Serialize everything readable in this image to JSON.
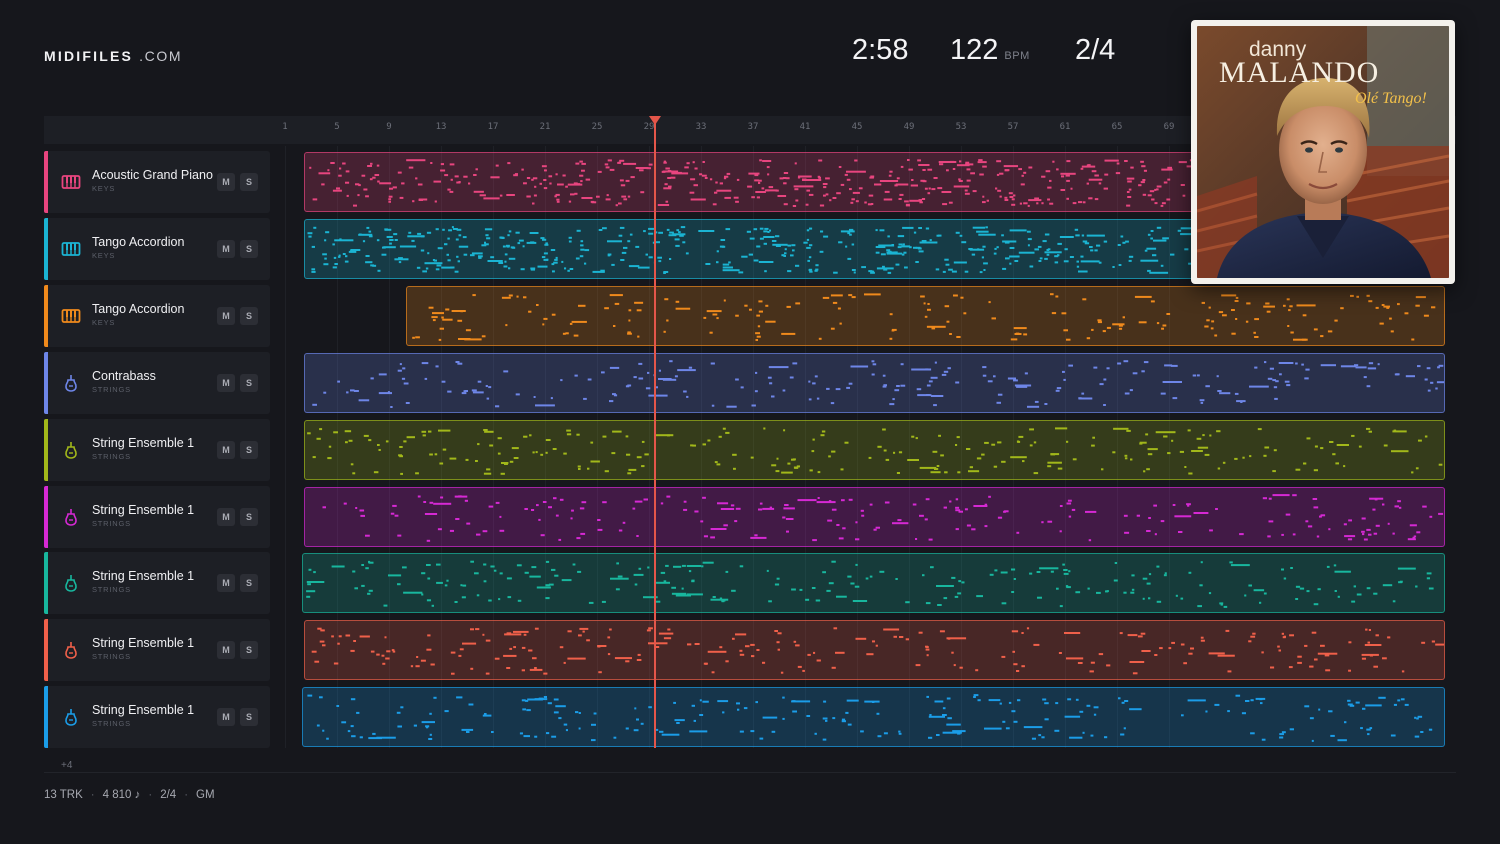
{
  "brand": {
    "name_bold": "MIDIFILES",
    "name_suffix": ".COM"
  },
  "stats": {
    "time": "2:58",
    "tempo": "122",
    "tempo_unit": "BPM",
    "time_signature": "2/4"
  },
  "ruler": {
    "ticks": [
      "1",
      "5",
      "9",
      "13",
      "17",
      "21",
      "25",
      "29",
      "33",
      "37",
      "41",
      "45",
      "49",
      "53",
      "57",
      "61",
      "65",
      "69"
    ],
    "playhead_bar": 29
  },
  "tracks": [
    {
      "name": "Acoustic Grand Piano",
      "category": "KEYS",
      "color": "#e8457f",
      "icon": "piano-icon",
      "mute": "M",
      "solo": "S"
    },
    {
      "name": "Tango Accordion",
      "category": "KEYS",
      "color": "#1bb4d3",
      "icon": "piano-icon",
      "mute": "M",
      "solo": "S"
    },
    {
      "name": "Tango Accordion",
      "category": "KEYS",
      "color": "#f08a1c",
      "icon": "piano-icon",
      "mute": "M",
      "solo": "S"
    },
    {
      "name": "Contrabass",
      "category": "STRINGS",
      "color": "#6e86e8",
      "icon": "violin-icon",
      "mute": "M",
      "solo": "S"
    },
    {
      "name": "String Ensemble 1",
      "category": "STRINGS",
      "color": "#a2b81a",
      "icon": "violin-icon",
      "mute": "M",
      "solo": "S"
    },
    {
      "name": "String Ensemble 1",
      "category": "STRINGS",
      "color": "#d629d4",
      "icon": "violin-icon",
      "mute": "M",
      "solo": "S"
    },
    {
      "name": "String Ensemble 1",
      "category": "STRINGS",
      "color": "#18b79e",
      "icon": "violin-icon",
      "mute": "M",
      "solo": "S"
    },
    {
      "name": "String Ensemble 1",
      "category": "STRINGS",
      "color": "#f0604a",
      "icon": "violin-icon",
      "mute": "M",
      "solo": "S"
    },
    {
      "name": "String Ensemble 1",
      "category": "STRINGS",
      "color": "#1b9de8",
      "icon": "violin-icon",
      "mute": "M",
      "solo": "S"
    }
  ],
  "more_tracks": "+4",
  "footer": {
    "tracks": "13 TRK",
    "notes": "4 810 ♪",
    "time_signature": "2/4",
    "standard": "GM"
  },
  "album": {
    "artist_first": "danny",
    "artist_last": "MALANDO",
    "title": "Olé Tango!"
  }
}
